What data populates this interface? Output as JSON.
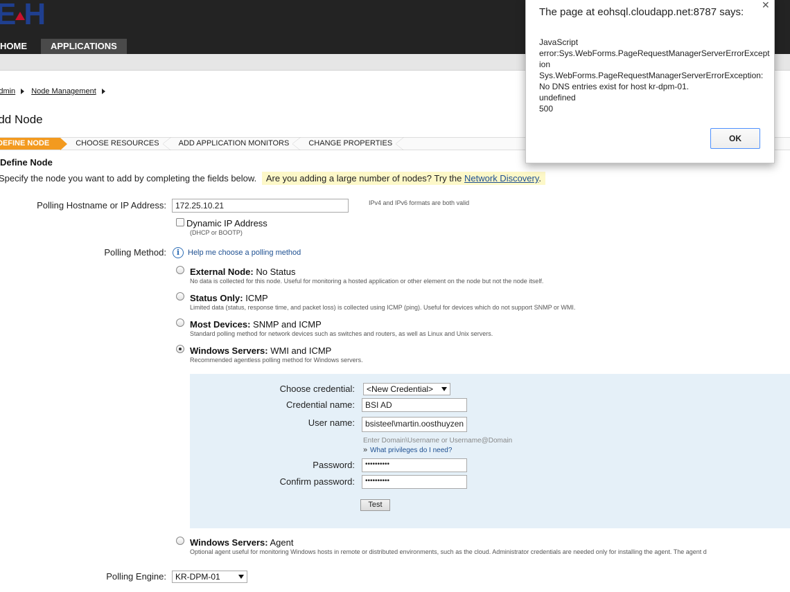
{
  "header": {
    "logo_text": "EOH",
    "nav": [
      {
        "label": "HOME"
      },
      {
        "label": "APPLICATIONS"
      }
    ]
  },
  "breadcrumb": [
    {
      "label": "Admin"
    },
    {
      "label": "Node Management"
    }
  ],
  "page_title": "Add Node",
  "wizard_steps": [
    {
      "label": "DEFINE NODE",
      "active": true
    },
    {
      "label": "CHOOSE RESOURCES"
    },
    {
      "label": "ADD APPLICATION MONITORS"
    },
    {
      "label": "CHANGE PROPERTIES"
    }
  ],
  "define_node": {
    "title": "Define Node",
    "intro": "Specify the node you want to add by completing the fields below.",
    "hint_text": "Are you adding a large number of nodes? Try the",
    "hint_link": "Network Discovery",
    "hint_suffix": "."
  },
  "polling_host": {
    "label": "Polling Hostname or IP Address:",
    "value": "172.25.10.21",
    "note": "IPv4 and IPv6 formats are both valid",
    "dynamic_ip_label": "Dynamic IP Address",
    "dynamic_ip_note": "(DHCP or BOOTP)"
  },
  "polling_method": {
    "label": "Polling Method:",
    "help_link": "Help me choose a polling method",
    "options": [
      {
        "name": "External Node:",
        "type": "No Status",
        "desc": "No data is collected for this node. Useful for monitoring a hosted application or other element on the node but not the node itself."
      },
      {
        "name": "Status Only:",
        "type": "ICMP",
        "desc": "Limited data (status, response time, and packet loss) is collected using ICMP (ping). Useful for devices which do not support SNMP or WMI."
      },
      {
        "name": "Most Devices:",
        "type": "SNMP and ICMP",
        "desc": "Standard polling method for network devices such as switches and routers, as well as Linux and Unix servers."
      },
      {
        "name": "Windows Servers:",
        "type": "WMI and ICMP",
        "desc": "Recommended agentless polling method for Windows servers.",
        "checked": true
      },
      {
        "name": "Windows Servers:",
        "type": "Agent",
        "desc": "Optional agent useful for monitoring Windows hosts in remote or distributed environments, such as the cloud. Administrator credentials are needed only for installing the agent. The agent d"
      }
    ]
  },
  "credentials": {
    "choose_label": "Choose credential:",
    "choose_value": "<New Credential>",
    "name_label": "Credential name:",
    "name_value": "BSI AD",
    "user_label": "User name:",
    "user_value": "bsisteel\\martin.oosthuyzen",
    "user_hint": "Enter Domain\\Username or Username@Domain",
    "privileges_link": "What privileges do I need?",
    "password_label": "Password:",
    "password_value": "••••••••••",
    "confirm_label": "Confirm password:",
    "confirm_value": "••••••••••",
    "test_button": "Test"
  },
  "polling_engine": {
    "label": "Polling Engine:",
    "value": "KR-DPM-01"
  },
  "alert_dialog": {
    "title": "The page at eohsql.cloudapp.net:8787 says:",
    "lines": [
      "JavaScript",
      "error:Sys.WebForms.PageRequestManagerServerErrorExcept",
      "ion",
      "Sys.WebForms.PageRequestManagerServerErrorException:",
      "No DNS entries exist for host kr-dpm-01.",
      "undefined",
      "500"
    ],
    "ok_label": "OK"
  }
}
